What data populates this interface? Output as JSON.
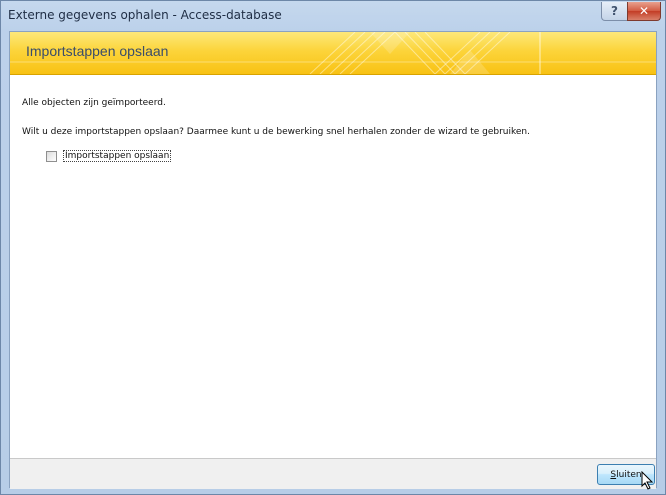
{
  "window": {
    "title": "Externe gegevens ophalen - Access-database",
    "help_glyph": "?",
    "close_glyph": "✕"
  },
  "header": {
    "title": "Importstappen opslaan"
  },
  "body": {
    "message_done": "Alle objecten zijn geïmporteerd.",
    "message_question": "Wilt u deze importstappen opslaan? Daarmee kunt u de bewerking snel herhalen zonder de wizard te gebruiken.",
    "checkbox_label": "Importstappen opslaan",
    "checkbox_checked": false
  },
  "footer": {
    "close_button_label_accel": "S",
    "close_button_label_rest": "luiten"
  },
  "colors": {
    "header_yellow": "#fcd43a",
    "title_text": "#3a4d6b",
    "window_frame": "#c5d8ee"
  }
}
